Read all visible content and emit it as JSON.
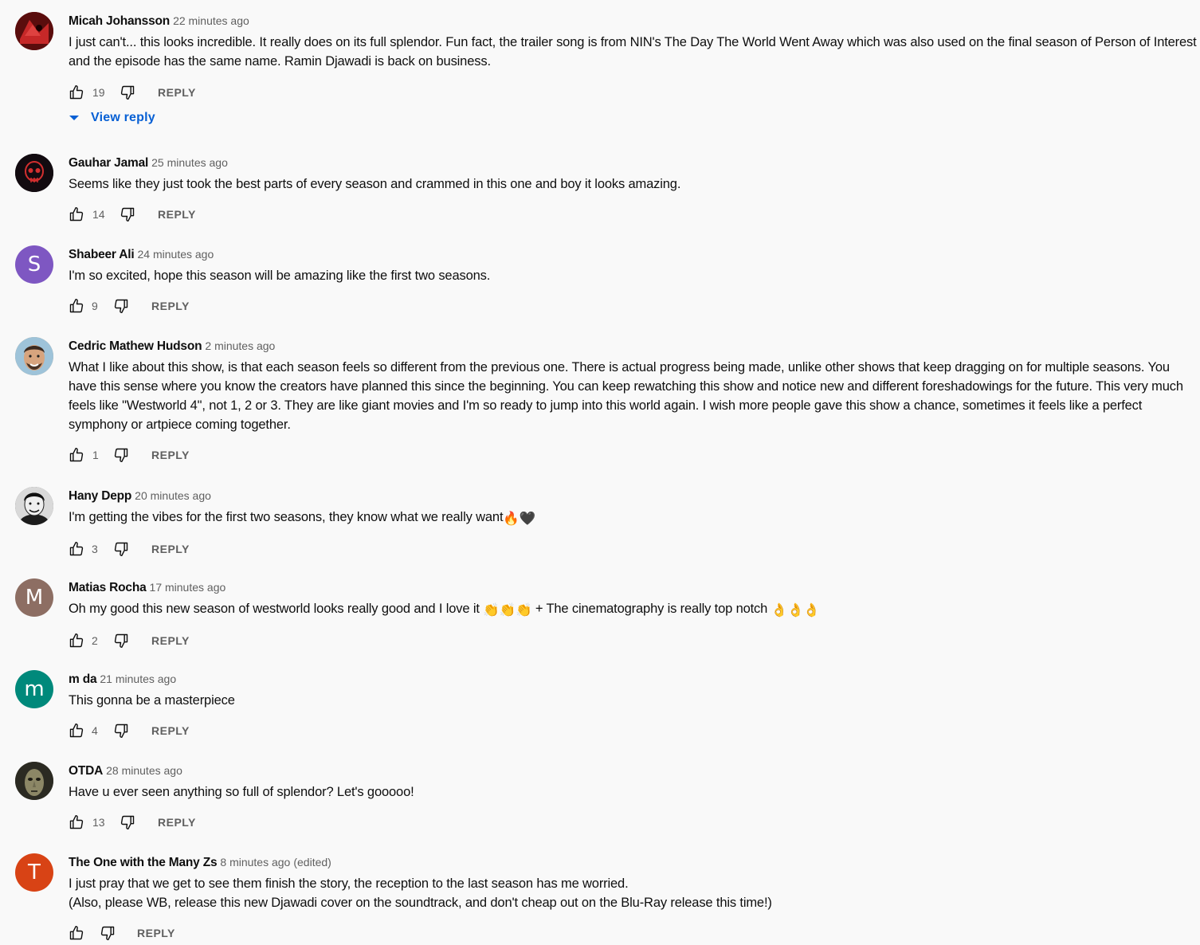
{
  "labels": {
    "reply": "REPLY",
    "view_reply": "View reply"
  },
  "colors": {
    "link_blue": "#065fd4",
    "secondary_text": "#606060"
  },
  "comments": [
    {
      "author": "Micah Johansson",
      "time": "22 minutes ago",
      "text": "I just can't... this looks incredible. It really does on its full splendor. Fun fact, the trailer song is from NIN's The Day The World Went Away which was also used on the final season of Person of Interest and the episode has the same name. Ramin Djawadi is back on business.",
      "likes": "19",
      "avatar": {
        "type": "image",
        "icon": "red-mask-avatar",
        "color": "#8b1a1a"
      }
    },
    {
      "author": "Gauhar Jamal",
      "time": "25 minutes ago",
      "text": "Seems like they just took the best parts of every season and crammed in this one and boy it looks amazing.",
      "likes": "14",
      "avatar": {
        "type": "image",
        "icon": "red-skull-avatar",
        "color": "#120b10"
      }
    },
    {
      "author": "Shabeer Ali",
      "time": "24 minutes ago",
      "text": "I'm so excited, hope this season will be amazing like the first two seasons.",
      "likes": "9",
      "avatar": {
        "type": "letter",
        "letter": "S",
        "color": "#7e57c2"
      }
    },
    {
      "author": "Cedric Mathew Hudson",
      "time": "2 minutes ago",
      "text": "What I like about this show, is that each season feels so different from the previous one. There is actual progress being made, unlike other shows that keep dragging on for multiple seasons. You have this sense where you know the creators have planned this since the beginning. You can keep rewatching this show and notice new and different foreshadowings for the future. This very much feels like \"Westworld 4\", not 1, 2 or 3. They are like giant movies and I'm so ready to jump into this world again. I wish more people gave this show a chance, sometimes it feels like a perfect symphony or artpiece coming together.",
      "likes": "1",
      "avatar": {
        "type": "image",
        "icon": "face-photo-avatar",
        "color": "#c49a6c"
      }
    },
    {
      "author": "Hany Depp",
      "time": "20 minutes ago",
      "text": "I'm getting the vibes for the first two seasons, they know what we really want",
      "emoji_suffix": "🔥🖤",
      "likes": "3",
      "avatar": {
        "type": "image",
        "icon": "bw-portrait-avatar",
        "color": "#555555"
      }
    },
    {
      "author": "Matias Rocha",
      "time": "17 minutes ago",
      "text": "Oh my good this new season of westworld looks really good and I love it",
      "emoji_mid": "👏👏👏",
      "text_after": " + The cinematography is really top notch ",
      "emoji_suffix": "👌👌👌",
      "likes": "2",
      "avatar": {
        "type": "letter",
        "letter": "M",
        "color": "#8d6e63"
      }
    },
    {
      "author": "m da",
      "time": "21 minutes ago",
      "text": "This gonna be a masterpiece",
      "likes": "4",
      "avatar": {
        "type": "letter",
        "letter": "m",
        "color": "#00897b"
      }
    },
    {
      "author": "OTDA",
      "time": "28 minutes ago",
      "text": "Have u ever seen anything so full of splendor? Let's gooooo!",
      "likes": "13",
      "avatar": {
        "type": "image",
        "icon": "masked-face-avatar",
        "color": "#6b6a55"
      }
    },
    {
      "author": "The One with the Many Zs",
      "time": "8 minutes ago",
      "edited": "(edited)",
      "text": "I just pray that we get to see them finish the story, the reception to the last season has me worried.\n(Also, please WB, release this new Djawadi cover on the soundtrack, and don't cheap out on the Blu-Ray release this time!)",
      "likes": "",
      "avatar": {
        "type": "letter",
        "letter": "T",
        "color": "#d84315"
      }
    }
  ]
}
